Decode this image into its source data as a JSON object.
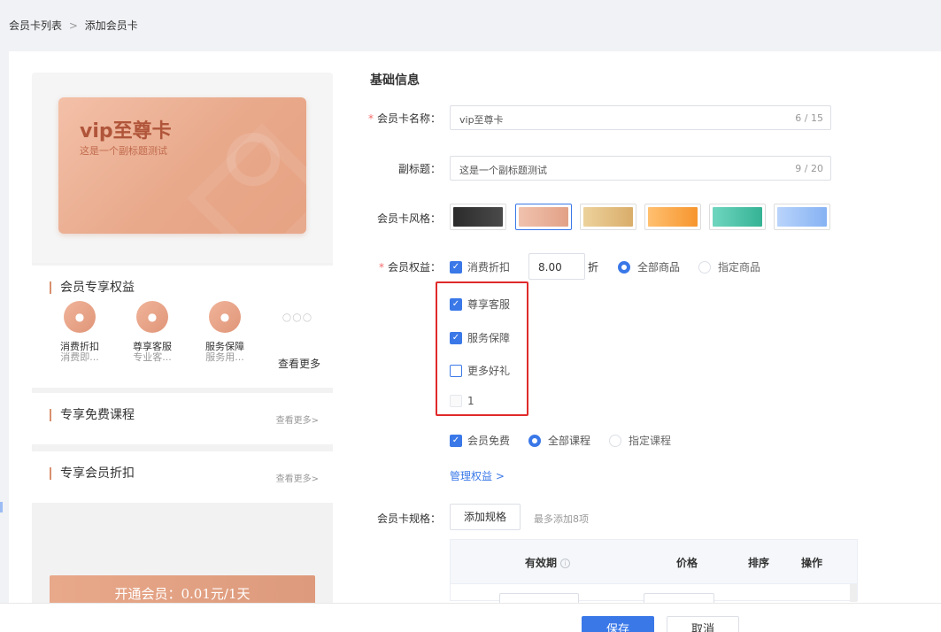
{
  "breadcrumb": {
    "parent": "会员卡列表",
    "separator": ">",
    "current": "添加会员卡"
  },
  "preview": {
    "card": {
      "title": "vip至尊卡",
      "subtitle": "这是一个副标题测试"
    },
    "benefits_section": {
      "title": "会员专享权益",
      "items": [
        {
          "name": "消费折扣",
          "desc": "消费即...",
          "icon": "tag-icon"
        },
        {
          "name": "尊享客服",
          "desc": "专业客...",
          "icon": "service-icon"
        },
        {
          "name": "服务保障",
          "desc": "服务用...",
          "icon": "shield-icon"
        }
      ],
      "more_dots": "○○○",
      "more_label": "查看更多"
    },
    "free_course": {
      "title": "专享免费课程",
      "link": "查看更多>"
    },
    "member_discount": {
      "title": "专享会员折扣",
      "link": "查看更多>"
    },
    "open_button": "开通会员：0.01元/1天"
  },
  "form": {
    "section_title": "基础信息",
    "name": {
      "label": "会员卡名称：",
      "value": "vip至尊卡",
      "count": "6 / 15"
    },
    "subtitle": {
      "label": "副标题：",
      "value": "这是一个副标题测试",
      "count": "9 / 20"
    },
    "style": {
      "label": "会员卡风格：",
      "swatches": [
        {
          "name": "dark",
          "from": "#2b2b2b",
          "to": "#4a4a4a"
        },
        {
          "name": "rose",
          "from": "#f0c2ae",
          "to": "#e2a187"
        },
        {
          "name": "gold",
          "from": "#edd29c",
          "to": "#d9ad6a"
        },
        {
          "name": "orange",
          "from": "#ffc070",
          "to": "#f6952e"
        },
        {
          "name": "teal",
          "from": "#6fd6bf",
          "to": "#35b294"
        },
        {
          "name": "sky",
          "from": "#b9d4fb",
          "to": "#86b2f3"
        }
      ]
    },
    "rights": {
      "label": "会员权益：",
      "discount_label": "消费折扣",
      "discount_value": "8.00",
      "discount_unit": "折",
      "scope_all": "全部商品",
      "scope_specific": "指定商品",
      "items": [
        "尊享客服",
        "服务保障",
        "更多好礼",
        "1"
      ],
      "free_label": "会员免费",
      "course_all": "全部课程",
      "course_specific": "指定课程",
      "manage_link": "管理权益 >"
    },
    "spec": {
      "label": "会员卡规格：",
      "add_button": "添加规格",
      "hint": "最多添加8项",
      "columns": [
        "有效期",
        "价格",
        "排序",
        "操作"
      ],
      "info_icon": "i"
    }
  },
  "footer": {
    "save": "保存",
    "cancel": "取消"
  },
  "colors": {
    "primary": "#3a78e8",
    "accent": "#e8a88a",
    "highlight": "#e02a2a"
  }
}
